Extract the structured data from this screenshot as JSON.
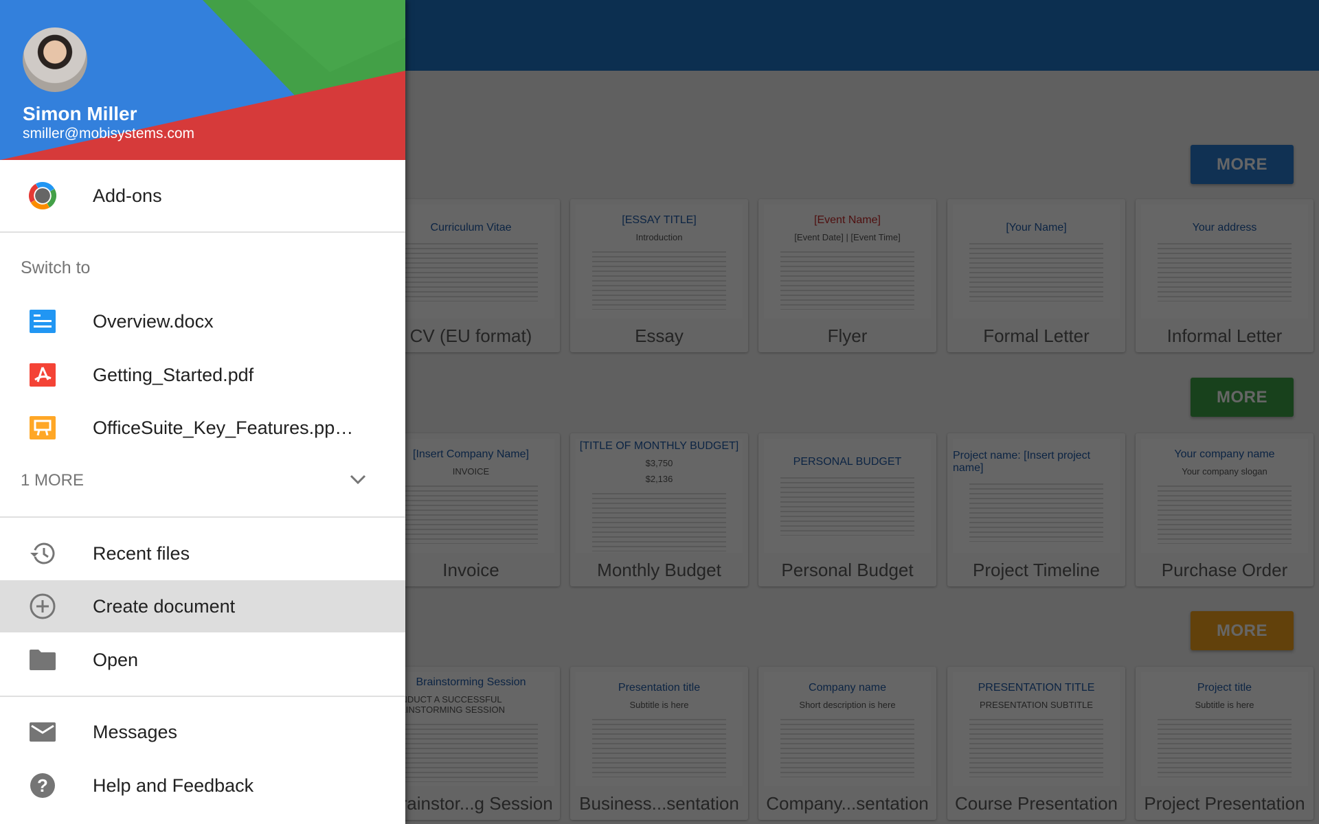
{
  "colors": {
    "topbar": "#1f77c8",
    "more_blue": "#2a7bd0",
    "more_green": "#3ea346",
    "more_orange": "#f4a41c",
    "header_blue": "#3380dc",
    "header_green": "#43a047",
    "header_red": "#d63a3a",
    "highlight": "#dddddd"
  },
  "drawer": {
    "user": {
      "name": "Simon Miller",
      "email": "smiller@mobisystems.com"
    },
    "addons": {
      "label": "Add-ons",
      "icon": "addons-gear-icon"
    },
    "switch_to": "Switch to",
    "recent_docs": [
      {
        "label": "Overview.docx",
        "icon": "docx-icon"
      },
      {
        "label": "Getting_Started.pdf",
        "icon": "pdf-icon"
      },
      {
        "label": "OfficeSuite_Key_Features.pp…",
        "icon": "pptx-icon"
      }
    ],
    "more": "1 MORE",
    "nav": [
      {
        "label": "Recent files",
        "icon": "history-icon"
      },
      {
        "label": "Create document",
        "icon": "add-circle-icon",
        "selected": true
      },
      {
        "label": "Open",
        "icon": "folder-icon"
      }
    ],
    "footer": [
      {
        "label": "Messages",
        "icon": "mail-icon"
      },
      {
        "label": "Help and Feedback",
        "icon": "help-icon"
      }
    ]
  },
  "main": {
    "sections": [
      {
        "more": "MORE",
        "templates": [
          {
            "label": "CV (EU format)",
            "thumb": [
              "Curriculum Vitae"
            ]
          },
          {
            "label": "Essay",
            "thumb": [
              "[ESSAY TITLE]",
              "Introduction"
            ]
          },
          {
            "label": "Flyer",
            "thumb": [
              "[Event Name]",
              "[Event Date] | [Event Time]"
            ]
          },
          {
            "label": "Formal Letter",
            "thumb": [
              "[Your Name]"
            ]
          },
          {
            "label": "Informal Letter",
            "thumb": [
              "Your address"
            ]
          }
        ]
      },
      {
        "more": "MORE",
        "templates": [
          {
            "label": "Invoice",
            "thumb": [
              "[Insert Company Name]",
              "INVOICE"
            ]
          },
          {
            "label": "Monthly Budget",
            "thumb": [
              "[TITLE OF MONTHLY BUDGET]",
              "$3,750",
              "$2,136"
            ]
          },
          {
            "label": "Personal Budget",
            "thumb": [
              "PERSONAL BUDGET"
            ]
          },
          {
            "label": "Project Timeline",
            "thumb": [
              "Project name: [Insert project name]"
            ]
          },
          {
            "label": "Purchase Order",
            "thumb": [
              "Your company name",
              "Your company slogan"
            ]
          }
        ]
      },
      {
        "more": "MORE",
        "templates": [
          {
            "label": "Brainstor...g Session",
            "thumb": [
              "Brainstorming Session",
              "CONDUCT A SUCCESSFUL BRAINSTORMING SESSION"
            ]
          },
          {
            "label": "Business...sentation",
            "thumb": [
              "Presentation title",
              "Subtitle is here"
            ]
          },
          {
            "label": "Company...sentation",
            "thumb": [
              "Company name",
              "Short description is here"
            ]
          },
          {
            "label": "Course Presentation",
            "thumb": [
              "PRESENTATION TITLE",
              "PRESENTATION SUBTITLE"
            ]
          },
          {
            "label": "Project Presentation",
            "thumb": [
              "Project title",
              "Subtitle is here"
            ]
          }
        ]
      }
    ]
  }
}
